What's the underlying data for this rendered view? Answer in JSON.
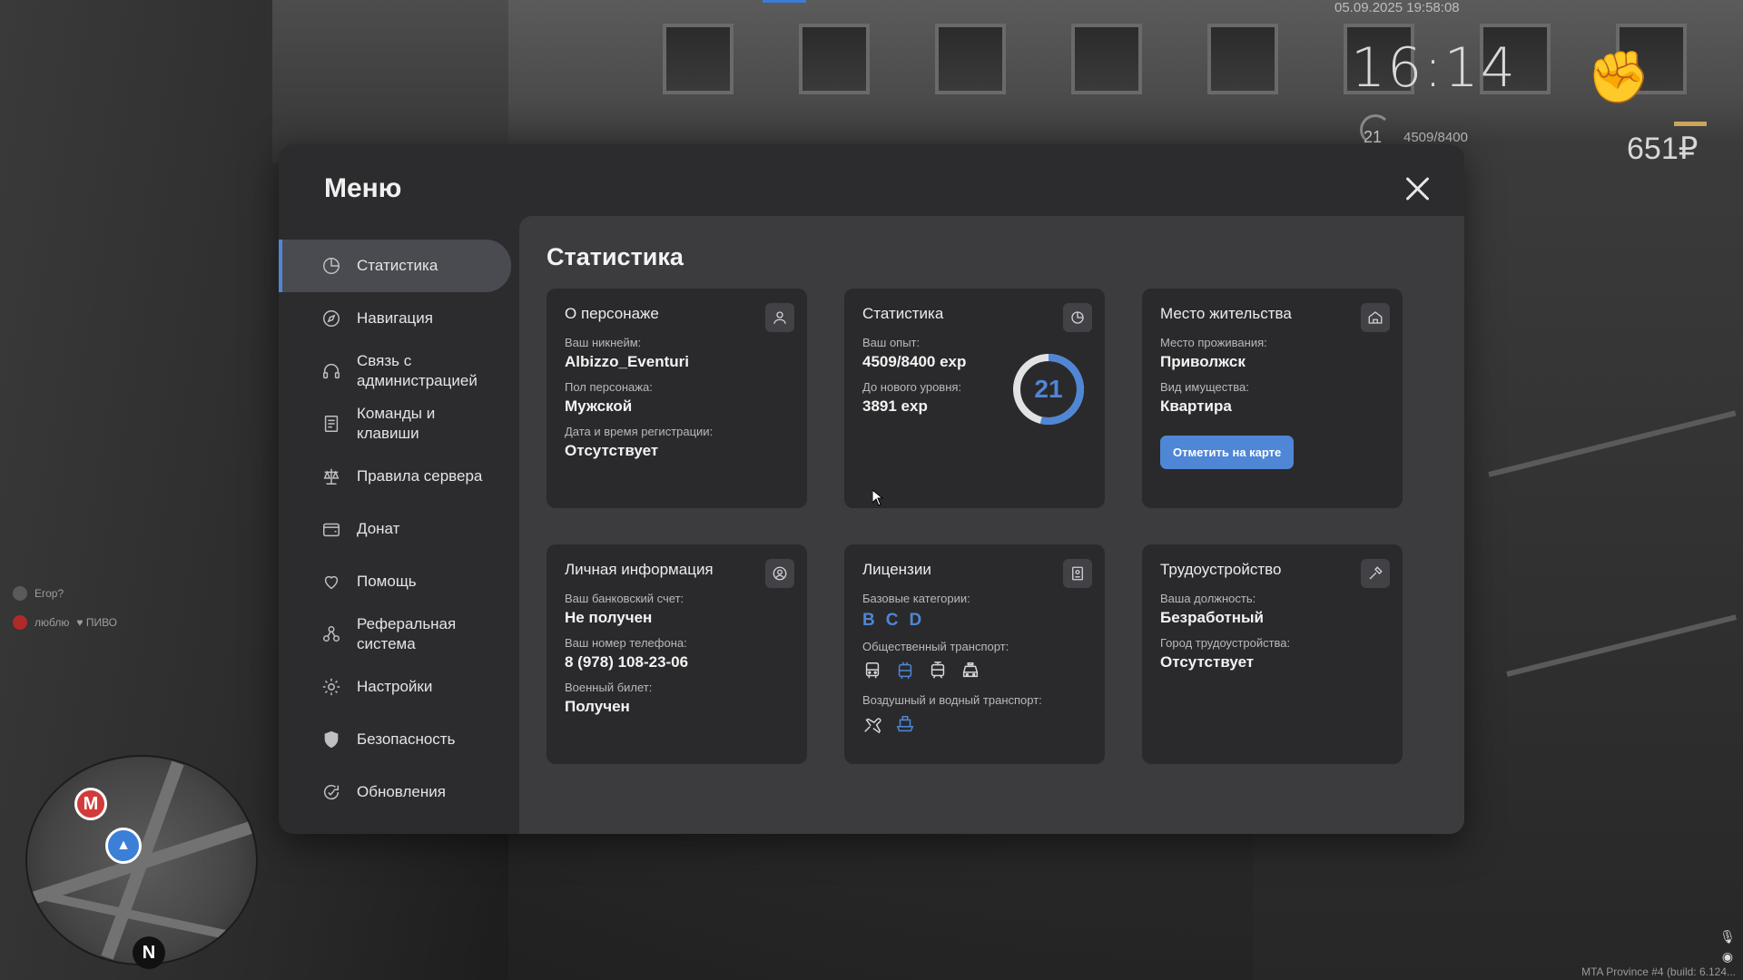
{
  "hud": {
    "datetime": "05.09.2025 19:58:08",
    "clock": "16:14",
    "level": "21",
    "exp": "4509/8400",
    "money": "651₽",
    "build": "MTA Province #4 (build: 6.124..."
  },
  "chat": [
    {
      "name": "Егор?",
      "text": ""
    },
    {
      "name": "люблю",
      "text": "ПИВО"
    }
  ],
  "minimap": {
    "metro_label": "M",
    "north_label": "N"
  },
  "menu": {
    "title": "Меню",
    "nav": [
      {
        "label": "Статистика",
        "icon": "chart-icon",
        "active": true
      },
      {
        "label": "Навигация",
        "icon": "compass-icon"
      },
      {
        "label": "Связь с администрацией",
        "icon": "headset-icon"
      },
      {
        "label": "Команды и клавиши",
        "icon": "list-icon"
      },
      {
        "label": "Правила сервера",
        "icon": "scales-icon"
      },
      {
        "label": "Донат",
        "icon": "wallet-icon"
      },
      {
        "label": "Помощь",
        "icon": "heart-hand-icon"
      },
      {
        "label": "Реферальная система",
        "icon": "referral-icon"
      },
      {
        "label": "Настройки",
        "icon": "gear-icon"
      },
      {
        "label": "Безопасность",
        "icon": "shield-icon"
      },
      {
        "label": "Обновления",
        "icon": "refresh-icon"
      }
    ]
  },
  "stats": {
    "title": "Статистика",
    "character": {
      "title": "О персонаже",
      "nickname_label": "Ваш никнейм:",
      "nickname": "Albizzo_Eventuri",
      "gender_label": "Пол персонажа:",
      "gender": "Мужской",
      "reg_label": "Дата и время регистрации:",
      "reg": "Отсутствует"
    },
    "statistics": {
      "title": "Статистика",
      "exp_label": "Ваш опыт:",
      "exp": "4509/8400 exp",
      "next_label": "До нового уровня:",
      "next": "3891 exp",
      "level": "21",
      "progress": 0.537
    },
    "residence": {
      "title": "Место жительства",
      "place_label": "Место проживания:",
      "place": "Приволжск",
      "property_label": "Вид имущества:",
      "property": "Квартира",
      "button": "Отметить на карте"
    },
    "personal": {
      "title": "Личная информация",
      "bank_label": "Ваш банковский счет:",
      "bank": "Не получен",
      "phone_label": "Ваш номер телефона:",
      "phone": "8 (978) 108-23-06",
      "military_label": "Военный билет:",
      "military": "Получен"
    },
    "licenses": {
      "title": "Лицензии",
      "base_label": "Базовые категории:",
      "categories": [
        "B",
        "C",
        "D"
      ],
      "public_label": "Общественный транспорт:",
      "air_label": "Воздушный и водный транспорт:"
    },
    "job": {
      "title": "Трудоустройство",
      "position_label": "Ваша должность:",
      "position": "Безработный",
      "city_label": "Город трудоустройства:",
      "city": "Отсутствует"
    }
  },
  "colors": {
    "accent": "#4f86d6",
    "panel": "#2c2c2e",
    "content": "#3c3c3f",
    "card": "#2a2a2c"
  }
}
